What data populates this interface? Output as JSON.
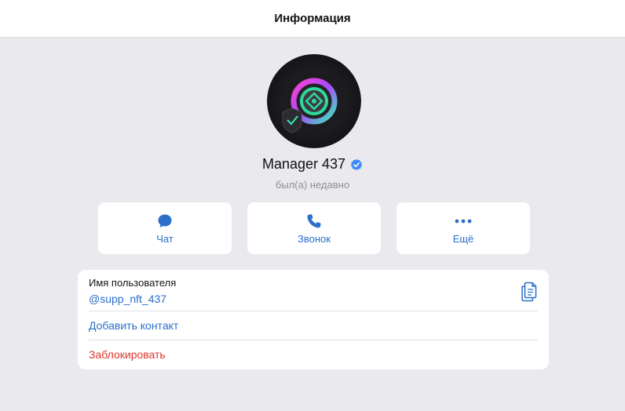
{
  "header": {
    "title": "Информация"
  },
  "profile": {
    "name": "Manager 437",
    "status": "был(а) недавно",
    "verified": true
  },
  "actions": [
    {
      "label": "Чат",
      "icon": "chat-bubble-icon"
    },
    {
      "label": "Звонок",
      "icon": "phone-icon"
    },
    {
      "label": "Ещё",
      "icon": "more-dots-icon"
    }
  ],
  "info": {
    "username_caption": "Имя пользователя",
    "username": "@supp_nft_437",
    "add_contact": "Добавить контакт",
    "block": "Заблокировать"
  },
  "colors": {
    "accent": "#2b6fc9",
    "danger": "#e0352b",
    "background": "#e9e9ee"
  }
}
